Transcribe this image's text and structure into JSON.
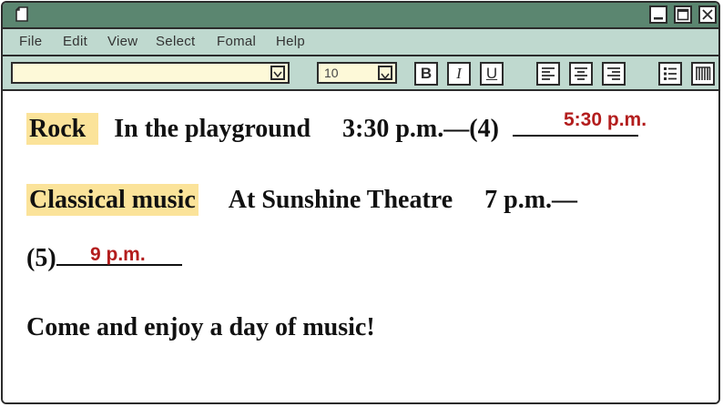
{
  "window": {
    "icons": {
      "document": "document-icon",
      "minimize": "minimize-icon",
      "maximize": "maximize-icon",
      "close": "close-icon"
    }
  },
  "menubar": {
    "items": [
      "File",
      "Edit",
      "View",
      "Select",
      "Fomal",
      "Help"
    ]
  },
  "toolbar": {
    "font_name": "",
    "font_size": "10",
    "bold_label": "B",
    "italic_label": "I",
    "underline_label": "U",
    "icons": [
      "align-left-icon",
      "align-center-icon",
      "align-right-icon",
      "bullet-list-icon",
      "columns-icon"
    ]
  },
  "document": {
    "line1": {
      "genre": "Rock",
      "place": "In the playground",
      "time": "3:30 p.m.—(4)",
      "answer": "5:30 p.m."
    },
    "line2": {
      "genre": "Classical music",
      "place": "At Sunshine Theatre",
      "time": "7 p.m.—"
    },
    "line3": {
      "label": "(5)",
      "answer": "9 p.m."
    },
    "line4": {
      "text": "Come and enjoy a day of music!"
    }
  },
  "colors": {
    "titlebar": "#5b8670",
    "menubar": "#bfd9cf",
    "highlight": "#fbe39a",
    "answer": "#b31d1d"
  }
}
